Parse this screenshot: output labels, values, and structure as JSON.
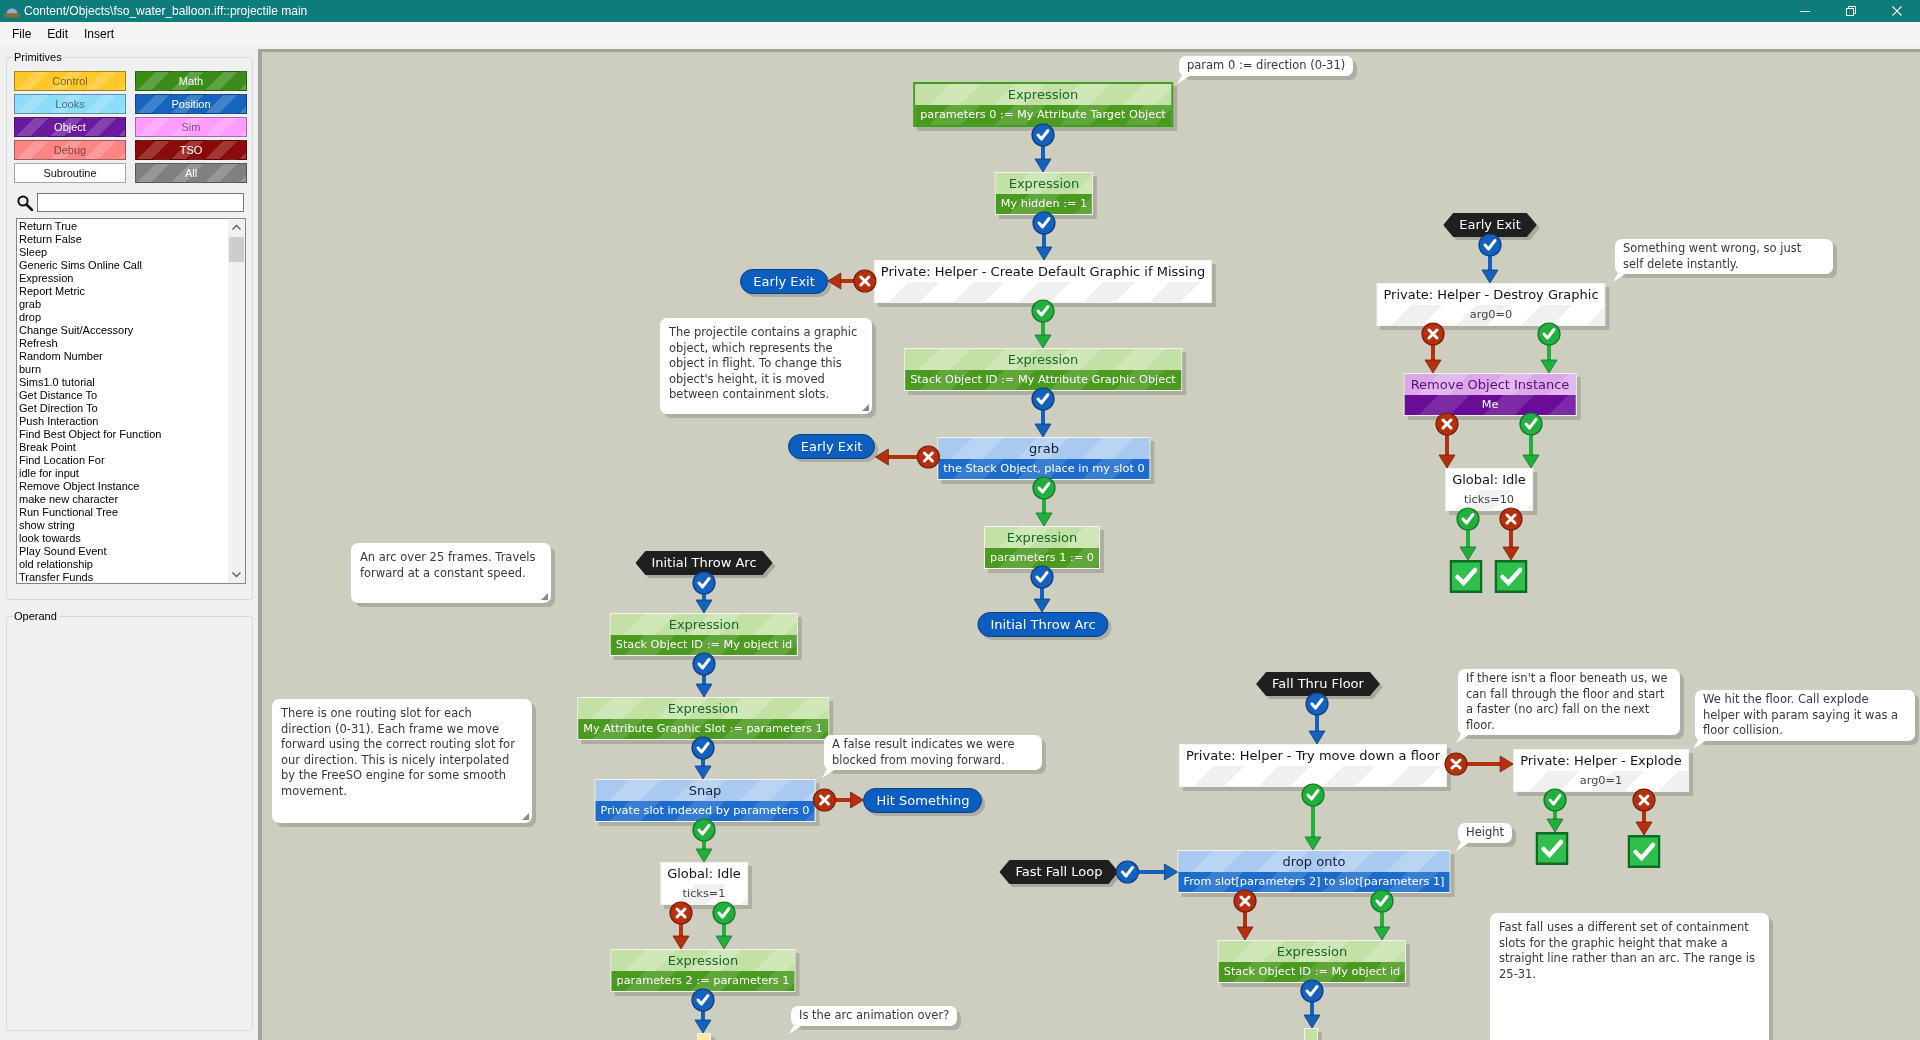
{
  "window": {
    "title": "Content/Objects\\fso_water_balloon.iff::projectile main"
  },
  "menu": [
    {
      "label": "File"
    },
    {
      "label": "Edit"
    },
    {
      "label": "Insert"
    }
  ],
  "primitives": {
    "title": "Primitives",
    "categories": [
      {
        "label": "Control",
        "color": "#ffc728"
      },
      {
        "label": "Math",
        "color": "#3c8c1a"
      },
      {
        "label": "Looks",
        "color": "#8cdcfa"
      },
      {
        "label": "Position",
        "color": "#1565c0"
      },
      {
        "label": "Object",
        "color": "#6a1a9e"
      },
      {
        "label": "Sim",
        "color": "#ff9cff"
      },
      {
        "label": "Debug",
        "color": "#ff8484"
      },
      {
        "label": "TSO",
        "color": "#8b0a0a"
      },
      {
        "label": "Subroutine",
        "color": "#ffffff"
      },
      {
        "label": "All",
        "color": "#808080"
      }
    ]
  },
  "primitive_list": {
    "items": [
      {
        "label": "Return True",
        "selected": false
      },
      {
        "label": "Return False",
        "selected": false
      },
      {
        "label": "Sleep",
        "selected": false
      },
      {
        "label": "Generic Sims Online Call",
        "selected": false
      },
      {
        "label": "Expression",
        "selected": false
      },
      {
        "label": "Report Metric",
        "selected": false
      },
      {
        "label": "grab",
        "selected": false
      },
      {
        "label": "drop",
        "selected": false
      },
      {
        "label": "Change Suit/Accessory",
        "selected": false
      },
      {
        "label": "Refresh",
        "selected": false
      },
      {
        "label": "Random Number",
        "selected": false
      },
      {
        "label": "burn",
        "selected": false
      },
      {
        "label": "Sims1.0 tutorial",
        "selected": false
      },
      {
        "label": "Get Distance To",
        "selected": false
      },
      {
        "label": "Get Direction To",
        "selected": false
      },
      {
        "label": "Push Interaction",
        "selected": false
      },
      {
        "label": "Find Best Object for Function",
        "selected": false
      },
      {
        "label": "Break Point",
        "selected": false
      },
      {
        "label": "Find Location For",
        "selected": false
      },
      {
        "label": "idle for input",
        "selected": false
      },
      {
        "label": "Remove Object Instance",
        "selected": false
      },
      {
        "label": "make new character",
        "selected": false
      },
      {
        "label": "Run Functional Tree",
        "selected": false
      },
      {
        "label": "show string",
        "selected": false
      },
      {
        "label": "look towards",
        "selected": false
      },
      {
        "label": "Play Sound Event",
        "selected": false
      },
      {
        "label": "old relationship",
        "selected": false
      },
      {
        "label": "Transfer Funds",
        "selected": false
      }
    ]
  },
  "operand": {
    "title": "Operand"
  },
  "canvas": {
    "nodes": [
      {
        "kind": "expression",
        "title": "Expression",
        "detail": "parameters 0 := My Attribute Target Object",
        "selected": true,
        "exits": [
          {
            "kind": "always"
          }
        ]
      },
      {
        "kind": "expression",
        "title": "Expression",
        "detail": "My hidden := 1",
        "selected": false,
        "exits": [
          {
            "kind": "always"
          }
        ]
      },
      {
        "kind": "goto",
        "title": "Early Exit",
        "selected": false
      },
      {
        "kind": "subroutine",
        "title": "Private: Helper - Create Default Graphic if Missing",
        "selected": false,
        "exits": [
          {
            "kind": "false"
          },
          {
            "kind": "true"
          }
        ]
      },
      {
        "kind": "expression",
        "title": "Expression",
        "detail": "Stack Object ID := My Attribute Graphic Object",
        "selected": false,
        "exits": [
          {
            "kind": "always"
          }
        ]
      },
      {
        "kind": "goto",
        "title": "Early Exit",
        "selected": false
      },
      {
        "kind": "position",
        "title": "grab",
        "detail": "the Stack Object, place in my slot 0",
        "selected": false,
        "exits": [
          {
            "kind": "false"
          },
          {
            "kind": "true"
          }
        ]
      },
      {
        "kind": "expression",
        "title": "Expression",
        "detail": "parameters 1 := 0",
        "selected": false,
        "exits": [
          {
            "kind": "always"
          }
        ]
      },
      {
        "kind": "goto",
        "title": "Initial Throw Arc",
        "selected": false
      },
      {
        "kind": "label",
        "title": "Initial Throw Arc",
        "selected": false,
        "exits": [
          {
            "kind": "always"
          }
        ]
      },
      {
        "kind": "expression",
        "title": "Expression",
        "detail": "Stack Object ID := My object id",
        "selected": false,
        "exits": [
          {
            "kind": "always"
          }
        ]
      },
      {
        "kind": "expression",
        "title": "Expression",
        "detail": "My Attribute Graphic Slot := parameters 1",
        "selected": false,
        "exits": [
          {
            "kind": "always"
          }
        ]
      },
      {
        "kind": "position",
        "title": "Snap",
        "detail": "Private slot indexed by parameters 0",
        "selected": false,
        "exits": [
          {
            "kind": "true"
          },
          {
            "kind": "false"
          }
        ]
      },
      {
        "kind": "goto",
        "title": "Hit Something",
        "selected": false
      },
      {
        "kind": "subroutine",
        "title": "Global: Idle",
        "detail": "ticks=1",
        "selected": false,
        "exits": [
          {
            "kind": "false"
          },
          {
            "kind": "true"
          }
        ]
      },
      {
        "kind": "expression",
        "title": "Expression",
        "detail": "parameters 2 := parameters 1",
        "selected": false,
        "exits": [
          {
            "kind": "always"
          }
        ]
      },
      {
        "kind": "control",
        "selected": false
      },
      {
        "kind": "label",
        "title": "Early Exit",
        "selected": false,
        "exits": [
          {
            "kind": "always"
          }
        ]
      },
      {
        "kind": "subroutine",
        "title": "Private: Helper - Destroy Graphic",
        "detail": "arg0=0",
        "selected": false,
        "exits": [
          {
            "kind": "false"
          },
          {
            "kind": "true"
          }
        ]
      },
      {
        "kind": "object",
        "title": "Remove Object Instance",
        "detail": "Me",
        "selected": false,
        "exits": [
          {
            "kind": "false"
          },
          {
            "kind": "true"
          }
        ]
      },
      {
        "kind": "subroutine",
        "title": "Global: Idle",
        "detail": "ticks=10",
        "selected": false,
        "exits": [
          {
            "kind": "true"
          },
          {
            "kind": "false"
          }
        ]
      },
      {
        "kind": "done",
        "selected": false
      },
      {
        "kind": "done",
        "selected": false
      },
      {
        "kind": "label",
        "title": "Fall Thru Floor",
        "selected": false,
        "exits": [
          {
            "kind": "always"
          }
        ]
      },
      {
        "kind": "subroutine",
        "title": "Private: Helper - Try move down a floor",
        "selected": false,
        "exits": [
          {
            "kind": "false"
          },
          {
            "kind": "true"
          }
        ]
      },
      {
        "kind": "subroutine",
        "title": "Private: Helper - Explode",
        "detail": "arg0=1",
        "selected": false,
        "exits": [
          {
            "kind": "true"
          },
          {
            "kind": "false"
          }
        ]
      },
      {
        "kind": "done",
        "selected": false
      },
      {
        "kind": "done",
        "selected": false
      },
      {
        "kind": "label",
        "title": "Fast Fall Loop",
        "selected": false,
        "exits": [
          {
            "kind": "always"
          }
        ]
      },
      {
        "kind": "position",
        "title": "drop onto",
        "detail": "From slot[parameters 2] to slot[parameters 1]",
        "selected": false,
        "exits": [
          {
            "kind": "false"
          },
          {
            "kind": "true"
          }
        ]
      },
      {
        "kind": "expression",
        "title": "Expression",
        "detail": "Stack Object ID := My object id",
        "selected": false,
        "exits": [
          {
            "kind": "always"
          }
        ]
      },
      {
        "kind": "expression",
        "selected": false
      }
    ],
    "comments": [
      {
        "kind": "bubble",
        "text": "param 0 := direction (0-31)"
      },
      {
        "kind": "note",
        "text": "The projectile contains a graphic object, which represents the object in flight. To change this object's height, it is moved between containment slots."
      },
      {
        "kind": "note",
        "text": "An arc over 25 frames. Travels forward at a constant speed."
      },
      {
        "kind": "bubble",
        "text": "Something went wrong, so just self delete instantly."
      },
      {
        "kind": "note",
        "text": "There is one routing slot for each direction (0-31). Each frame we move forward using the correct routing slot for our direction. This is nicely interpolated by the FreeSO engine for some smooth movement."
      },
      {
        "kind": "bubble",
        "text": "A false result indicates we were blocked from moving forward."
      },
      {
        "kind": "bubble",
        "text": "Is the arc animation over?"
      },
      {
        "kind": "bubble",
        "text": "If there isn't a floor beneath us, we can fall through the floor and start a faster (no arc) fall on the next floor."
      },
      {
        "kind": "bubble",
        "text": "We hit the floor. Call explode helper with param saying it was a floor collision."
      },
      {
        "kind": "bubble",
        "text": "Height"
      },
      {
        "kind": "plain",
        "text": "Fast fall uses a different set of containment slots for the graphic height that make a straight line rather than an arc. The range is 25-31."
      }
    ]
  }
}
